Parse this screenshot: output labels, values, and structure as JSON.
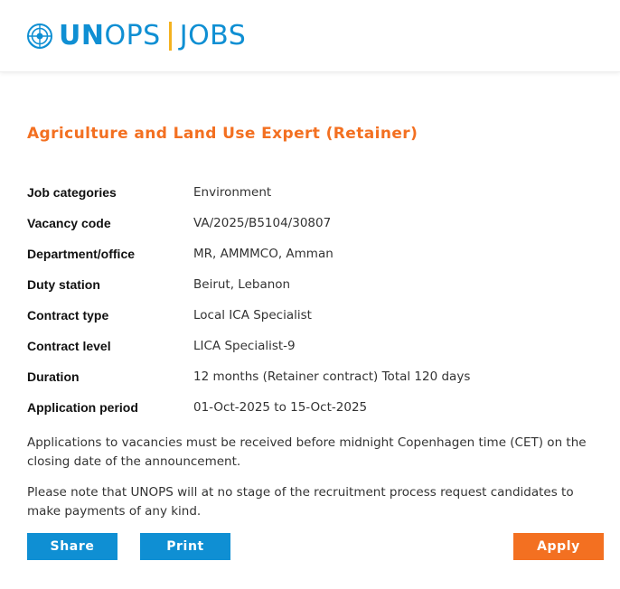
{
  "header": {
    "logo_un": "UN",
    "logo_ops": "OPS",
    "logo_jobs": "JOBS",
    "brand_color": "#0f8fd3",
    "separator_color": "#f4b21f"
  },
  "job": {
    "title": "Agriculture and Land Use Expert (Retainer)",
    "title_color": "#f37021",
    "details": [
      {
        "label": "Job categories",
        "value": "Environment"
      },
      {
        "label": "Vacancy code",
        "value": "VA/2025/B5104/30807"
      },
      {
        "label": "Department/office",
        "value": "MR, AMMMCO, Amman"
      },
      {
        "label": "Duty station",
        "value": "Beirut, Lebanon"
      },
      {
        "label": "Contract type",
        "value": "Local ICA Specialist"
      },
      {
        "label": "Contract level",
        "value": "LICA Specialist-9"
      },
      {
        "label": "Duration",
        "value": "12 months (Retainer contract) Total 120 days"
      },
      {
        "label": "Application period",
        "value": "01-Oct-2025 to 15-Oct-2025"
      }
    ],
    "note_deadline": "Applications to vacancies must be received before midnight Copenhagen time (CET) on the closing date of the announcement.",
    "note_payments": "Please note that UNOPS will at no stage of the recruitment process request candidates to make payments of any kind."
  },
  "actions": {
    "share_label": "Share",
    "print_label": "Print",
    "apply_label": "Apply",
    "primary_color": "#0f8fd3",
    "apply_color": "#f37021"
  }
}
